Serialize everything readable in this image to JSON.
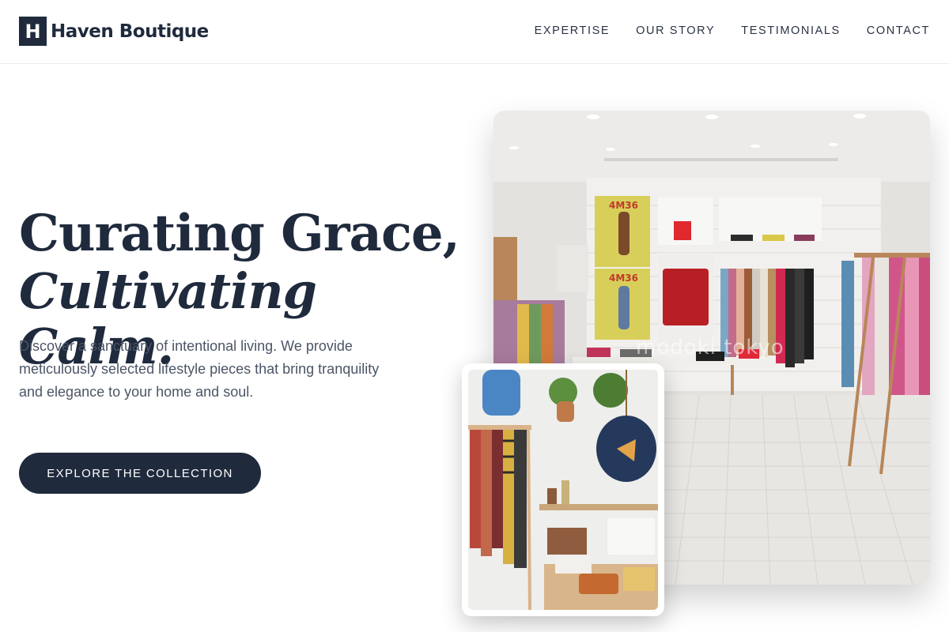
{
  "brand": {
    "logo_letter": "H",
    "name": "Haven Boutique"
  },
  "nav": {
    "items": [
      {
        "label": "EXPERTISE"
      },
      {
        "label": "OUR STORY"
      },
      {
        "label": "TESTIMONIALS"
      },
      {
        "label": "CONTACT"
      }
    ]
  },
  "hero": {
    "headline_line1": "Curating Grace,",
    "headline_line2": "Cultivating Calm.",
    "description": "Discover a sanctuary of intentional living. We provide meticulously selected lifestyle pieces that bring tranquility and elegance to your home and soul.",
    "cta_label": "EXPLORE THE COLLECTION"
  },
  "images": {
    "store_watermark": "modoki tokyo",
    "poster_label": "4M36"
  },
  "colors": {
    "primary": "#1f2a3d",
    "text_muted": "#4b5566",
    "background": "#ffffff"
  }
}
